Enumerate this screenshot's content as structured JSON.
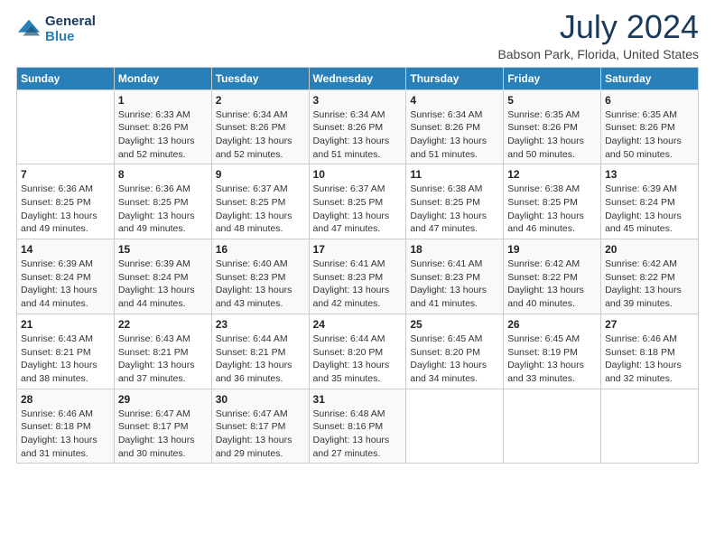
{
  "logo": {
    "general": "General",
    "blue": "Blue"
  },
  "title": {
    "month": "July 2024",
    "location": "Babson Park, Florida, United States"
  },
  "days_of_week": [
    "Sunday",
    "Monday",
    "Tuesday",
    "Wednesday",
    "Thursday",
    "Friday",
    "Saturday"
  ],
  "weeks": [
    [
      {
        "day": "",
        "info": ""
      },
      {
        "day": "1",
        "info": "Sunrise: 6:33 AM\nSunset: 8:26 PM\nDaylight: 13 hours and 52 minutes."
      },
      {
        "day": "2",
        "info": "Sunrise: 6:34 AM\nSunset: 8:26 PM\nDaylight: 13 hours and 52 minutes."
      },
      {
        "day": "3",
        "info": "Sunrise: 6:34 AM\nSunset: 8:26 PM\nDaylight: 13 hours and 51 minutes."
      },
      {
        "day": "4",
        "info": "Sunrise: 6:34 AM\nSunset: 8:26 PM\nDaylight: 13 hours and 51 minutes."
      },
      {
        "day": "5",
        "info": "Sunrise: 6:35 AM\nSunset: 8:26 PM\nDaylight: 13 hours and 50 minutes."
      },
      {
        "day": "6",
        "info": "Sunrise: 6:35 AM\nSunset: 8:26 PM\nDaylight: 13 hours and 50 minutes."
      }
    ],
    [
      {
        "day": "7",
        "info": "Sunrise: 6:36 AM\nSunset: 8:25 PM\nDaylight: 13 hours and 49 minutes."
      },
      {
        "day": "8",
        "info": "Sunrise: 6:36 AM\nSunset: 8:25 PM\nDaylight: 13 hours and 49 minutes."
      },
      {
        "day": "9",
        "info": "Sunrise: 6:37 AM\nSunset: 8:25 PM\nDaylight: 13 hours and 48 minutes."
      },
      {
        "day": "10",
        "info": "Sunrise: 6:37 AM\nSunset: 8:25 PM\nDaylight: 13 hours and 47 minutes."
      },
      {
        "day": "11",
        "info": "Sunrise: 6:38 AM\nSunset: 8:25 PM\nDaylight: 13 hours and 47 minutes."
      },
      {
        "day": "12",
        "info": "Sunrise: 6:38 AM\nSunset: 8:25 PM\nDaylight: 13 hours and 46 minutes."
      },
      {
        "day": "13",
        "info": "Sunrise: 6:39 AM\nSunset: 8:24 PM\nDaylight: 13 hours and 45 minutes."
      }
    ],
    [
      {
        "day": "14",
        "info": "Sunrise: 6:39 AM\nSunset: 8:24 PM\nDaylight: 13 hours and 44 minutes."
      },
      {
        "day": "15",
        "info": "Sunrise: 6:39 AM\nSunset: 8:24 PM\nDaylight: 13 hours and 44 minutes."
      },
      {
        "day": "16",
        "info": "Sunrise: 6:40 AM\nSunset: 8:23 PM\nDaylight: 13 hours and 43 minutes."
      },
      {
        "day": "17",
        "info": "Sunrise: 6:41 AM\nSunset: 8:23 PM\nDaylight: 13 hours and 42 minutes."
      },
      {
        "day": "18",
        "info": "Sunrise: 6:41 AM\nSunset: 8:23 PM\nDaylight: 13 hours and 41 minutes."
      },
      {
        "day": "19",
        "info": "Sunrise: 6:42 AM\nSunset: 8:22 PM\nDaylight: 13 hours and 40 minutes."
      },
      {
        "day": "20",
        "info": "Sunrise: 6:42 AM\nSunset: 8:22 PM\nDaylight: 13 hours and 39 minutes."
      }
    ],
    [
      {
        "day": "21",
        "info": "Sunrise: 6:43 AM\nSunset: 8:21 PM\nDaylight: 13 hours and 38 minutes."
      },
      {
        "day": "22",
        "info": "Sunrise: 6:43 AM\nSunset: 8:21 PM\nDaylight: 13 hours and 37 minutes."
      },
      {
        "day": "23",
        "info": "Sunrise: 6:44 AM\nSunset: 8:21 PM\nDaylight: 13 hours and 36 minutes."
      },
      {
        "day": "24",
        "info": "Sunrise: 6:44 AM\nSunset: 8:20 PM\nDaylight: 13 hours and 35 minutes."
      },
      {
        "day": "25",
        "info": "Sunrise: 6:45 AM\nSunset: 8:20 PM\nDaylight: 13 hours and 34 minutes."
      },
      {
        "day": "26",
        "info": "Sunrise: 6:45 AM\nSunset: 8:19 PM\nDaylight: 13 hours and 33 minutes."
      },
      {
        "day": "27",
        "info": "Sunrise: 6:46 AM\nSunset: 8:18 PM\nDaylight: 13 hours and 32 minutes."
      }
    ],
    [
      {
        "day": "28",
        "info": "Sunrise: 6:46 AM\nSunset: 8:18 PM\nDaylight: 13 hours and 31 minutes."
      },
      {
        "day": "29",
        "info": "Sunrise: 6:47 AM\nSunset: 8:17 PM\nDaylight: 13 hours and 30 minutes."
      },
      {
        "day": "30",
        "info": "Sunrise: 6:47 AM\nSunset: 8:17 PM\nDaylight: 13 hours and 29 minutes."
      },
      {
        "day": "31",
        "info": "Sunrise: 6:48 AM\nSunset: 8:16 PM\nDaylight: 13 hours and 27 minutes."
      },
      {
        "day": "",
        "info": ""
      },
      {
        "day": "",
        "info": ""
      },
      {
        "day": "",
        "info": ""
      }
    ]
  ]
}
